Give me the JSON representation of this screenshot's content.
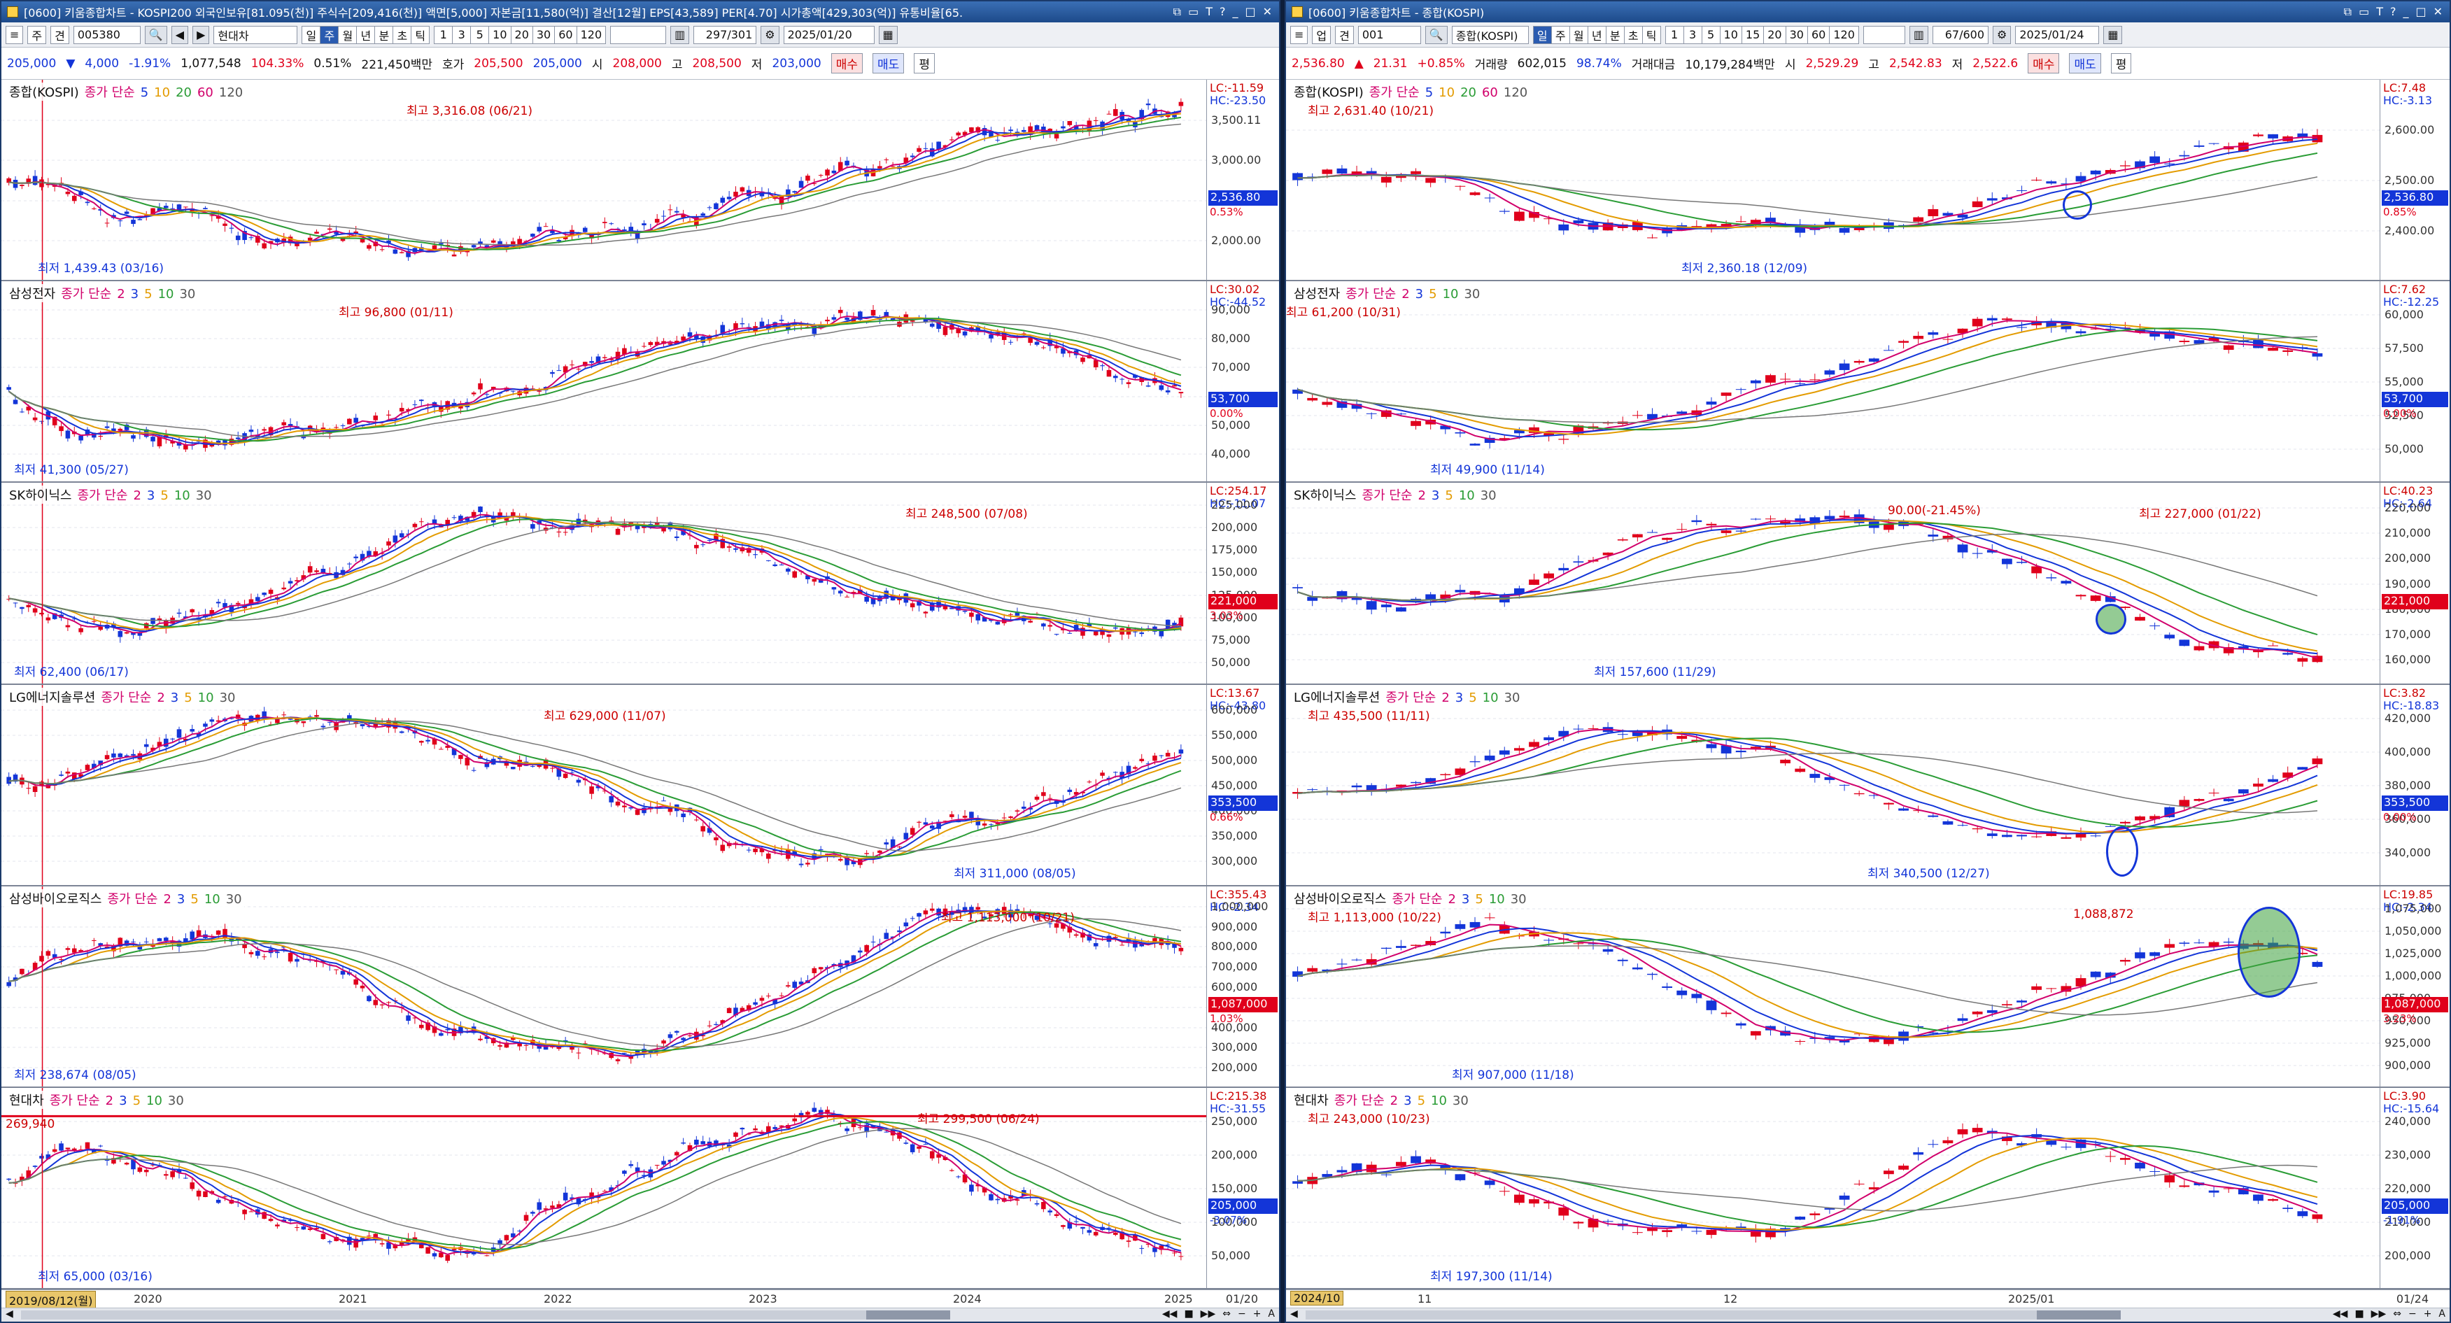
{
  "left": {
    "title": "[0600] 키움종합차트 - KOSPI200 외국인보유[81.095(천)] 주식수[209,416(천)] 액면[5,000] 자본금[11,580(억)] 결산[12월] EPS[43,589] PER[4.70] 시가총액[429,303(억)] 유통비율[65.",
    "toolbar": {
      "mode": "주",
      "view": "견",
      "code": "005380",
      "name": "현대차",
      "periods": [
        "일",
        "주",
        "월",
        "년",
        "분",
        "초",
        "틱"
      ],
      "selected": "주",
      "nums": [
        "1",
        "3",
        "5",
        "10",
        "20",
        "30",
        "60",
        "120"
      ],
      "count": "297/301",
      "date": "2025/01/20"
    },
    "quote": {
      "price": "205,000",
      "arrow": "▼",
      "change": "4,000",
      "pct": "-1.91%",
      "volume": "1,077,548",
      "vol_ratio": "104.33%",
      "turn": "0.51%",
      "amount": "221,450백만",
      "bid_lbl": "호가",
      "bid": "205,500",
      "ask": "205,000",
      "open_lbl": "시",
      "open": "208,000",
      "high_lbl": "고",
      "high": "208,500",
      "low_lbl": "저",
      "low": "203,000",
      "buy": "매수",
      "sell": "매도",
      "flat": "평"
    },
    "panels": [
      {
        "name": "종합(KOSPI)",
        "ma_label": "종가 단순",
        "ma": [
          "5",
          "10",
          "20",
          "60",
          "120"
        ],
        "lc": "LC:-11.59",
        "hc": "HC:-23.50",
        "price": "2,536.80",
        "pct": "0.53%",
        "hi": "최고 3,316.08 (06/21)",
        "lo": "최저 1,439.43 (03/16)",
        "ticks": [
          "3,500.11",
          "3,000.00",
          "2,500.00",
          "2,000.00"
        ]
      },
      {
        "name": "삼성전자",
        "ma_label": "종가 단순",
        "ma": [
          "2",
          "3",
          "5",
          "10",
          "30"
        ],
        "lc": "LC:30.02",
        "hc": "HC:-44.52",
        "price": "53,700",
        "pct": "0.00%",
        "hi": "최고 96,800 (01/11)",
        "lo": "최저 41,300 (05/27)",
        "ticks": [
          "90,000",
          "80,000",
          "70,000",
          "60,000",
          "50,000",
          "40,000"
        ]
      },
      {
        "name": "SK하이닉스",
        "ma_label": "종가 단순",
        "ma": [
          "2",
          "3",
          "5",
          "10",
          "30"
        ],
        "lc": "LC:254.17",
        "hc": "HC:-11.07",
        "price": "221,000",
        "pct": "3.03%",
        "hi": "최고 248,500 (07/08)",
        "lo": "최저 62,400 (06/17)",
        "ticks": [
          "225,000",
          "200,000",
          "175,000",
          "150,000",
          "125,000",
          "100,000",
          "75,000",
          "50,000"
        ]
      },
      {
        "name": "LG에너지솔루션",
        "ma_label": "종가 단순",
        "ma": [
          "2",
          "3",
          "5",
          "10",
          "30"
        ],
        "lc": "LC:13.67",
        "hc": "HC:-43.80",
        "price": "353,500",
        "pct": "0.66%",
        "hi": "최고 629,000 (11/07)",
        "lo": "최저 311,000 (08/05)",
        "ticks": [
          "600,000",
          "550,000",
          "500,000",
          "450,000",
          "400,000",
          "350,000",
          "300,000"
        ]
      },
      {
        "name": "삼성바이오로직스",
        "ma_label": "종가 단순",
        "ma": [
          "2",
          "3",
          "5",
          "10",
          "30"
        ],
        "lc": "LC:355.43",
        "hc": "HC:-2.34",
        "price": "1,087,000",
        "pct": "1.03%",
        "hi": "최고 1,113,000 (10/21)",
        "lo": "최저 238,674 (08/05)",
        "ticks": [
          "1,000,000",
          "900,000",
          "800,000",
          "700,000",
          "600,000",
          "500,000",
          "400,000",
          "300,000",
          "200,000"
        ]
      },
      {
        "name": "현대차",
        "ma_label": "종가 단순",
        "ma": [
          "2",
          "3",
          "5",
          "10",
          "30"
        ],
        "lc": "LC:215.38",
        "hc": "HC:-31.55",
        "price": "205,000",
        "pct": "-3.07%",
        "hi": "최고 299,500 (06/24)",
        "lo": "최저 65,000 (03/16)",
        "hline": "269,940",
        "ticks": [
          "250,000",
          "200,000",
          "150,000",
          "100,000",
          "50,000"
        ]
      }
    ],
    "xaxis": {
      "sel": "2019/08/12(월)",
      "labels": [
        "2020",
        "2021",
        "2022",
        "2023",
        "2024",
        "2025"
      ],
      "end": "01/20"
    }
  },
  "right": {
    "title": "[0600] 키움종합차트 - 종합(KOSPI)",
    "toolbar": {
      "mode": "업",
      "view": "견",
      "code": "001",
      "name": "종합(KOSPI)",
      "periods": [
        "일",
        "주",
        "월",
        "년",
        "분",
        "초",
        "틱"
      ],
      "selected": "일",
      "nums": [
        "1",
        "3",
        "5",
        "10",
        "15",
        "20",
        "30",
        "60",
        "120"
      ],
      "count": "67/600",
      "date": "2025/01/24"
    },
    "quote": {
      "price": "2,536.80",
      "arrow": "▲",
      "change": "21.31",
      "pct": "+0.85%",
      "vol_lbl": "거래량",
      "volume": "602,015",
      "vol_ratio": "98.74%",
      "amt_lbl": "거래대금",
      "amount": "10,179,284백만",
      "open_lbl": "시",
      "open": "2,529.29",
      "high_lbl": "고",
      "high": "2,542.83",
      "low_lbl": "저",
      "low": "2,522.6",
      "buy": "매수",
      "sell": "매도",
      "flat": "평"
    },
    "panels": [
      {
        "name": "종합(KOSPI)",
        "ma_label": "종가 단순",
        "ma": [
          "5",
          "10",
          "20",
          "60",
          "120"
        ],
        "lc": "LC:7.48",
        "hc": "HC:-3.13",
        "price": "2,536.80",
        "pct": "0.85%",
        "hi": "최고 2,631.40 (10/21)",
        "lo": "최저 2,360.18 (12/09)",
        "ticks": [
          "2,600.00",
          "2,500.00",
          "2,400.00"
        ]
      },
      {
        "name": "삼성전자",
        "ma_label": "종가 단순",
        "ma": [
          "2",
          "3",
          "5",
          "10",
          "30"
        ],
        "lc": "LC:7.62",
        "hc": "HC:-12.25",
        "price": "53,700",
        "pct": "0.00%",
        "hi": "최고 61,200 (10/31)",
        "lo": "최저 49,900 (11/14)",
        "ticks": [
          "60,000",
          "57,500",
          "55,000",
          "52,500",
          "50,000"
        ]
      },
      {
        "name": "SK하이닉스",
        "ma_label": "종가 단순",
        "ma": [
          "2",
          "3",
          "5",
          "10",
          "30"
        ],
        "lc": "LC:40.23",
        "hc": "HC:-2.64",
        "price": "221,000",
        "pct": "",
        "hi": "최고 227,000 (01/22)",
        "lo": "최저 157,600 (11/29)",
        "note": "90.00(-21.45%)",
        "ticks": [
          "220,000",
          "210,000",
          "200,000",
          "190,000",
          "180,000",
          "170,000",
          "160,000"
        ]
      },
      {
        "name": "LG에너지솔루션",
        "ma_label": "종가 단순",
        "ma": [
          "2",
          "3",
          "5",
          "10",
          "30"
        ],
        "lc": "LC:3.82",
        "hc": "HC:-18.83",
        "price": "353,500",
        "pct": "0.00%",
        "hi": "최고 435,500 (11/11)",
        "lo": "최저 340,500 (12/27)",
        "ticks": [
          "420,000",
          "400,000",
          "380,000",
          "360,000",
          "340,000"
        ]
      },
      {
        "name": "삼성바이오로직스",
        "ma_label": "종가 단순",
        "ma": [
          "2",
          "3",
          "5",
          "10",
          "30"
        ],
        "lc": "LC:19.85",
        "hc": "HC:-2.34",
        "price": "1,087,000",
        "pct": "3.23%",
        "hi": "최고 1,113,000 (10/22)",
        "lo": "최저 907,000 (11/18)",
        "note": "1,088,872",
        "ticks": [
          "1,075,000",
          "1,050,000",
          "1,025,000",
          "1,000,000",
          "975,000",
          "950,000",
          "925,000",
          "900,000"
        ]
      },
      {
        "name": "현대차",
        "ma_label": "종가 단순",
        "ma": [
          "2",
          "3",
          "5",
          "10",
          "30"
        ],
        "lc": "LC:3.90",
        "hc": "HC:-15.64",
        "price": "205,000",
        "pct": "-1.91%",
        "hi": "최고 243,000 (10/23)",
        "lo": "최저 197,300 (11/14)",
        "ticks": [
          "240,000",
          "230,000",
          "220,000",
          "210,000",
          "200,000"
        ]
      }
    ],
    "xaxis": {
      "sel": "2024/10",
      "labels": [
        "11",
        "12",
        "2025/01"
      ],
      "end": "01/24"
    }
  },
  "colors": {
    "up": "#e0001b",
    "down": "#1335d8",
    "ma2": "#d1006b",
    "ma3": "#1335d8",
    "ma5": "#e39b00",
    "ma10": "#2a9c35",
    "ma30": "#777777"
  },
  "icons": [
    "app-icon",
    "restore-icon",
    "maximize-icon",
    "help-icon",
    "minimize-icon",
    "close-icon",
    "scroll-left-icon",
    "scroll-right-icon",
    "zoom-in-icon",
    "zoom-out-icon"
  ]
}
